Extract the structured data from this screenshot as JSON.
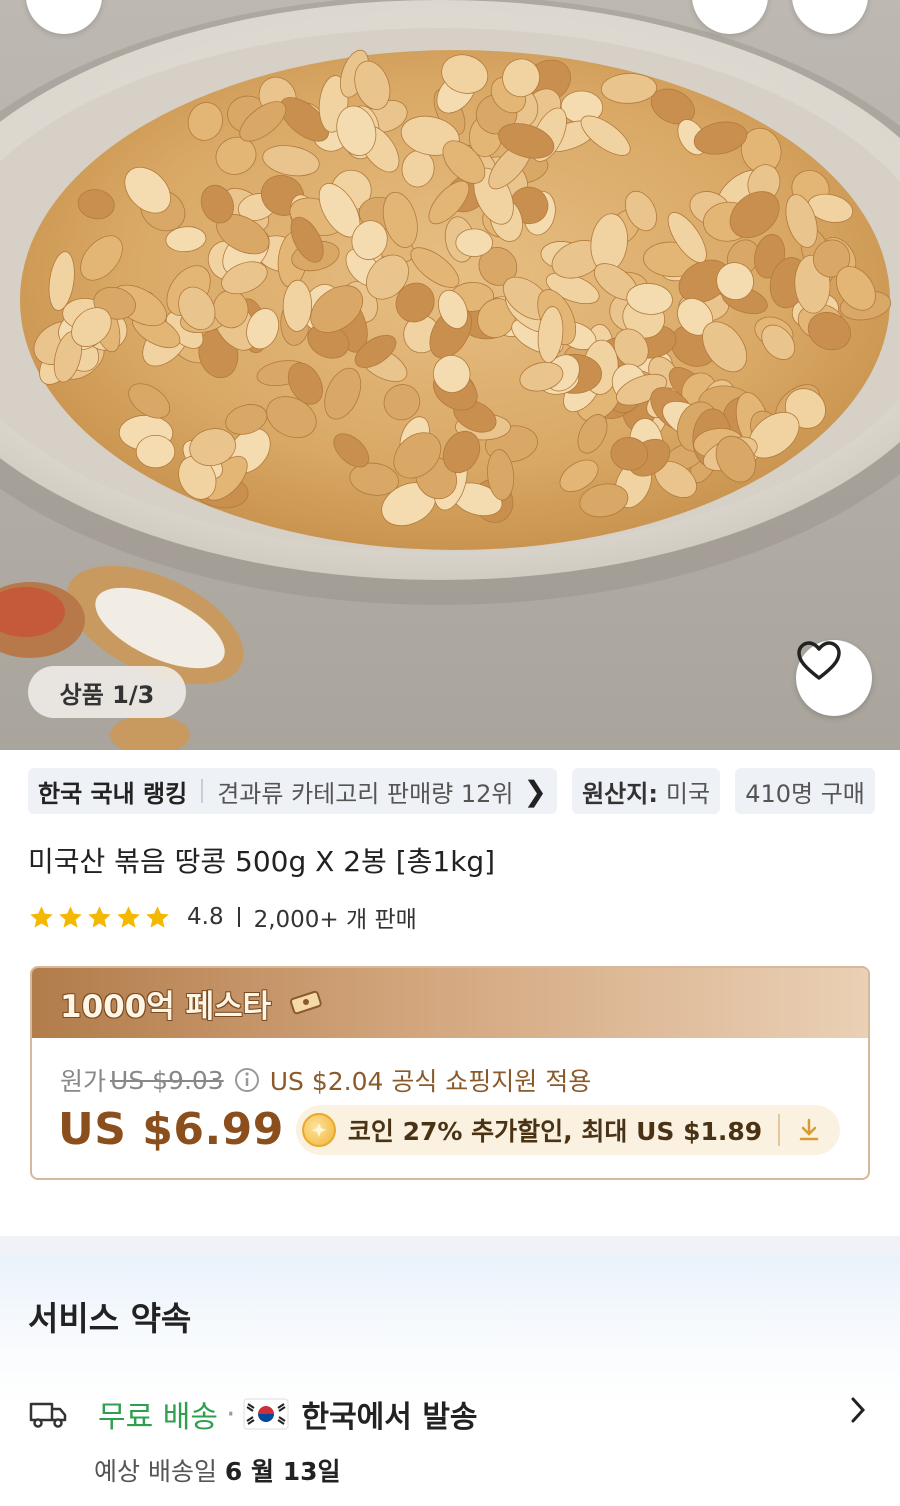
{
  "hero": {
    "image_counter": "상품 1/3",
    "icons": [
      "back-icon",
      "search-icon",
      "share-icon",
      "heart-icon"
    ]
  },
  "chips": {
    "ranking_label": "한국 국내 랭킹",
    "ranking_detail": "견과류 카테고리 판매량 12위",
    "origin_label": "원산지:",
    "origin_value": "미국",
    "buyers": "410명 구매"
  },
  "product": {
    "title": "미국산 볶음 땅콩 500g X 2봉 [총1kg]",
    "rating_value": "4.8",
    "rating_stars": 5,
    "sales": "2,000+ 개 판매"
  },
  "promo": {
    "banner": "1000억 페스타",
    "original_label": "원가",
    "original_price": "US $9.03",
    "support_text": "US $2.04 공식 쇼핑지원 적용",
    "price": "US $6.99",
    "coin_text": "코인 27% 추가할인, 최대 US $1.89"
  },
  "service": {
    "title": "서비스 약속",
    "free_shipping": "무료 배송",
    "ship_from": "한국에서 발송",
    "eta_label": "예상 배송일",
    "eta_date": "6 월 13일"
  },
  "colors": {
    "price": "#8a4f1c",
    "free_shipping": "#2f9f4e",
    "star": "#f5b800",
    "promo_header": "#b27c4b"
  }
}
